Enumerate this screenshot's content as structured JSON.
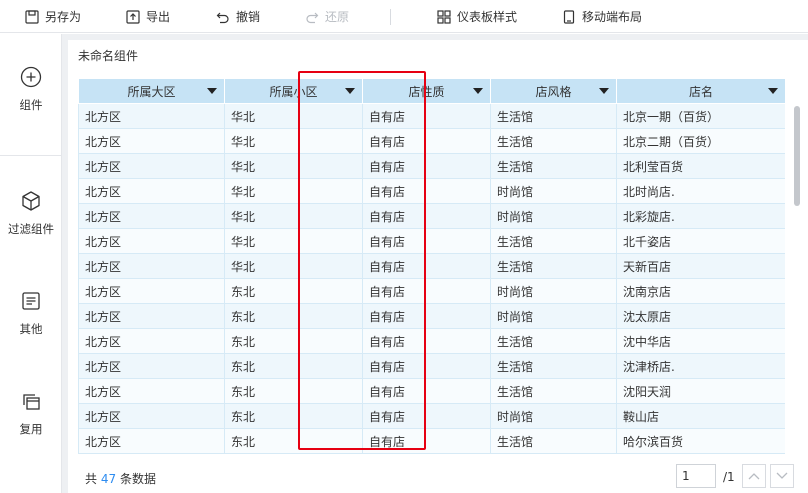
{
  "toolbar": {
    "save_as": "另存为",
    "export": "导出",
    "undo": "撤销",
    "redo": "还原",
    "dashboard_style": "仪表板样式",
    "mobile_layout": "移动端布局"
  },
  "sidebar": {
    "items": [
      {
        "label": "组件",
        "icon": "plus-circle-icon"
      },
      {
        "label": "过滤组件",
        "icon": "cube-icon"
      },
      {
        "label": "其他",
        "icon": "document-icon"
      },
      {
        "label": "复用",
        "icon": "stack-icon"
      }
    ]
  },
  "widget": {
    "title": "未命名组件",
    "table": {
      "columns": [
        "所属大区",
        "所属小区",
        "店性质",
        "店风格",
        "店名"
      ],
      "rows": [
        [
          "北方区",
          "华北",
          "自有店",
          "生活馆",
          "北京一期（百货）"
        ],
        [
          "北方区",
          "华北",
          "自有店",
          "生活馆",
          "北京二期（百货）"
        ],
        [
          "北方区",
          "华北",
          "自有店",
          "生活馆",
          "北利莹百货"
        ],
        [
          "北方区",
          "华北",
          "自有店",
          "时尚馆",
          "北时尚店."
        ],
        [
          "北方区",
          "华北",
          "自有店",
          "时尚馆",
          "北彩旋店."
        ],
        [
          "北方区",
          "华北",
          "自有店",
          "生活馆",
          "北千姿店"
        ],
        [
          "北方区",
          "华北",
          "自有店",
          "生活馆",
          "天新百店"
        ],
        [
          "北方区",
          "东北",
          "自有店",
          "时尚馆",
          "沈南京店"
        ],
        [
          "北方区",
          "东北",
          "自有店",
          "时尚馆",
          "沈太原店"
        ],
        [
          "北方区",
          "东北",
          "自有店",
          "生活馆",
          "沈中华店"
        ],
        [
          "北方区",
          "东北",
          "自有店",
          "生活馆",
          "沈津桥店."
        ],
        [
          "北方区",
          "东北",
          "自有店",
          "生活馆",
          "沈阳天润"
        ],
        [
          "北方区",
          "东北",
          "自有店",
          "时尚馆",
          "鞍山店"
        ],
        [
          "北方区",
          "东北",
          "自有店",
          "生活馆",
          "哈尔滨百货"
        ]
      ]
    },
    "footer": {
      "total_prefix": "共",
      "total_count": "47",
      "total_suffix": "条数据",
      "current_page": "1",
      "page_total": "/1"
    }
  },
  "colors": {
    "header_bg": "#c6e3f5",
    "row_bg": "#eef7fc",
    "highlight_border": "#e60012",
    "count_blue": "#2d8cf0"
  }
}
